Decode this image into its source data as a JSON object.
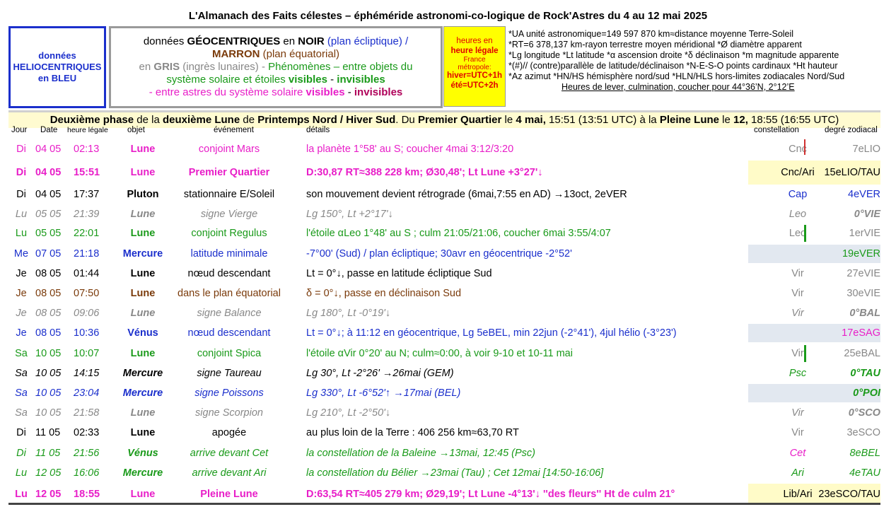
{
  "title": "L'Almanach des Faits célestes – éphéméride astronomi-co-logique de Rock'Astres du 4 au 12 mai 2025",
  "helio": "données HELIOCENTRIQUES en BLEU",
  "geo": {
    "l1a": "données ",
    "l1b": "GÉOCENTRIQUES",
    "l1c": " en ",
    "l1d": "NOIR",
    "l1e": " (plan écliptique)  /",
    "l2a": "MARRON",
    "l2b": " (plan équatorial)",
    "l3a": "en ",
    "l3b": "GRIS",
    "l3c": " (ingrès lunaires)  -  ",
    "l3d": "Phénomènes – entre objets du",
    "l4a": "système solaire et étoiles ",
    "l4b": "visibles",
    "l4c": " - ",
    "l4d": "invisibles",
    "l5a": "- entre astres du système solaire ",
    "l5b": "visibles",
    "l5c": " - ",
    "l5d": "invisibles"
  },
  "legal": {
    "l1": "heures en",
    "l2": "heure légale",
    "l3": "France",
    "l4": "métropole:",
    "l5": "hiver=UTC+1h",
    "l6": "été=UTC+2h"
  },
  "notes": [
    "*UA unité astronomique=149 597 870 km≈distance moyenne Terre-Soleil",
    "*RT=6 378,137 km-rayon terrestre moyen méridional   *Ø diamètre apparent",
    "*Lg longitude *Lt latitude   *α ascension droite *δ déclinaison   *m magnitude apparente",
    "*(#)// (contre)parallèle de latitude/déclinaison   *N-E-S-O points cardinaux   *Ht hauteur",
    "*Az azimut   *HN/HS hémisphère nord/sud   *HLN/HLS hors-limites zodiacales Nord/Sud"
  ],
  "notes_u": "Heures de lever, culmination, coucher pour 44°36’N, 2°12’E",
  "phase": {
    "a": "Deuxième phase",
    "b": " de la ",
    "c": "deuxième Lune",
    "d": " de ",
    "e": "Printemps Nord / Hiver Sud",
    "f": ". Du ",
    "g": "Premier Quartier",
    "h": " le ",
    "i": "4 mai,",
    "j": " 15:51 (13:51 UTC) à la ",
    "k": "Pleine Lune",
    "l": " le ",
    "m": "12,",
    "n": " 18:55 (16:55 UTC)"
  },
  "headers": {
    "day": "Jour",
    "date": "Date",
    "hour": "heure légale",
    "obj": "objet",
    "ev": "événement",
    "det": "détails",
    "con": "constellation",
    "deg": "degré zodiacal"
  },
  "colors": {
    "magenta": "#e81ec8",
    "blue": "#1b2fcc",
    "brown": "#7a3a0a",
    "gray": "#888888",
    "green": "#1a9a1a",
    "black": "#000000"
  },
  "rows": [
    {
      "day": "Di",
      "date": "04 05",
      "hour": "02:13",
      "obj": "Lune",
      "ev": "conjoint Mars",
      "det": "la planète 1°58' au S; coucher 4mai 3:12/3:20",
      "con": "Cnc",
      "deg": "7eLIO"
    },
    {
      "day": "Di",
      "date": "04 05",
      "hour": "15:51",
      "obj": "Lune",
      "ev": "Premier Quartier",
      "det": "D:30,87 RT≈388 228 km; Ø30,48'; Lt Lune +3°27'↓",
      "con": "Cnc/Ari",
      "deg": "15eLIO/TAU"
    },
    {
      "day": "Di",
      "date": "04 05",
      "hour": "17:37",
      "obj": "Pluton",
      "ev": "stationnaire E/Soleil",
      "det": "son mouvement devient rétrograde (6mai,7:55 en AD) →13oct, 2eVER",
      "con": "Cap",
      "deg": "4eVER"
    },
    {
      "day": "Lu",
      "date": "05 05",
      "hour": "21:39",
      "obj": "Lune",
      "ev": "signe Vierge",
      "det": "Lg 150°, Lt +2°17'↓",
      "con": "Leo",
      "deg": "0°VIE"
    },
    {
      "day": "Lu",
      "date": "05 05",
      "hour": "22:01",
      "obj": "Lune",
      "ev": "conjoint Regulus",
      "det": "l'étoile αLeo 1°48' au S ; culm 21:05/21:06, coucher 6mai 3:55/4:07",
      "con": "Leo",
      "deg": "1erVIE"
    },
    {
      "day": "Me",
      "date": "07 05",
      "hour": "21:18",
      "obj": "Mercure",
      "ev": "latitude minimale",
      "det": "-7°00' (Sud) / plan écliptique; 30avr en géocentrique -2°52'",
      "con": "",
      "deg": "19eVER"
    },
    {
      "day": "Je",
      "date": "08 05",
      "hour": "01:44",
      "obj": "Lune",
      "ev": "nœud descendant",
      "det": "Lt = 0°↓, passe en latitude écliptique Sud",
      "con": "Vir",
      "deg": "27eVIE"
    },
    {
      "day": "Je",
      "date": "08 05",
      "hour": "07:50",
      "obj": "Lune",
      "ev": "dans le plan équatorial",
      "det": "δ = 0°↓, passe en déclinaison Sud",
      "con": "Vir",
      "deg": "30eVIE"
    },
    {
      "day": "Je",
      "date": "08 05",
      "hour": "09:06",
      "obj": "Lune",
      "ev": "signe Balance",
      "det": "Lg 180°, Lt -0°19'↓",
      "con": "Vir",
      "deg": "0°BAL"
    },
    {
      "day": "Je",
      "date": "08 05",
      "hour": "10:36",
      "obj": "Vénus",
      "ev": "nœud descendant",
      "det": "Lt = 0°↓; à 11:12 en géocentrique, Lg 5eBEL, min 22jun (-2°41'), 4jul hélio (-3°23')",
      "con": "",
      "deg": "17eSAG"
    },
    {
      "day": "Sa",
      "date": "10 05",
      "hour": "10:07",
      "obj": "Lune",
      "ev": "conjoint Spica",
      "det": "l'étoile αVir 0°20' au N; culm≈0:00, à voir 9-10 et 10-11 mai",
      "con": "Vir",
      "deg": "25eBAL"
    },
    {
      "day": "Sa",
      "date": "10 05",
      "hour": "14:15",
      "obj": "Mercure",
      "ev": "signe Taureau",
      "det": "Lg 30°, Lt -2°26' →26mai (GEM)",
      "con": "Psc",
      "deg": "0°TAU"
    },
    {
      "day": "Sa",
      "date": "10 05",
      "hour": "23:04",
      "obj": "Mercure",
      "ev": "signe Poissons",
      "det": "Lg 330°, Lt -6°52'↑ →17mai (BEL)",
      "con": "",
      "deg": "0°POI"
    },
    {
      "day": "Sa",
      "date": "10 05",
      "hour": "21:58",
      "obj": "Lune",
      "ev": "signe Scorpion",
      "det": "Lg 210°, Lt -2°50'↓",
      "con": "Vir",
      "deg": "0°SCO"
    },
    {
      "day": "Di",
      "date": "11 05",
      "hour": "02:33",
      "obj": "Lune",
      "ev": "apogée",
      "det": "au plus loin de la Terre : 406 256 km≈63,70 RT",
      "con": "Vir",
      "deg": "3eSCO"
    },
    {
      "day": "Di",
      "date": "11 05",
      "hour": "21:56",
      "obj": "Vénus",
      "ev": "arrive devant Cet",
      "det": "la constellation de la Baleine →13mai, 12:45 (Psc)",
      "con": "Cet",
      "deg": "8eBEL"
    },
    {
      "day": "Lu",
      "date": "12 05",
      "hour": "16:06",
      "obj": "Mercure",
      "ev": "arrive devant Ari",
      "det": "la constellation du Bélier →23mai (Tau) ; Cet 12mai [14:50-16:06]",
      "con": "Ari",
      "deg": "4eTAU"
    },
    {
      "day": "Lu",
      "date": "12 05",
      "hour": "18:55",
      "obj": "Lune",
      "ev": "Pleine Lune",
      "det": "D:63,54 RT≈405 279 km; Ø29,19'; Lt Lune -4°13'↓ ''des fleurs'' Ht de culm 21°",
      "con": "Lib/Ari",
      "deg": "23eSCO/TAU"
    }
  ]
}
